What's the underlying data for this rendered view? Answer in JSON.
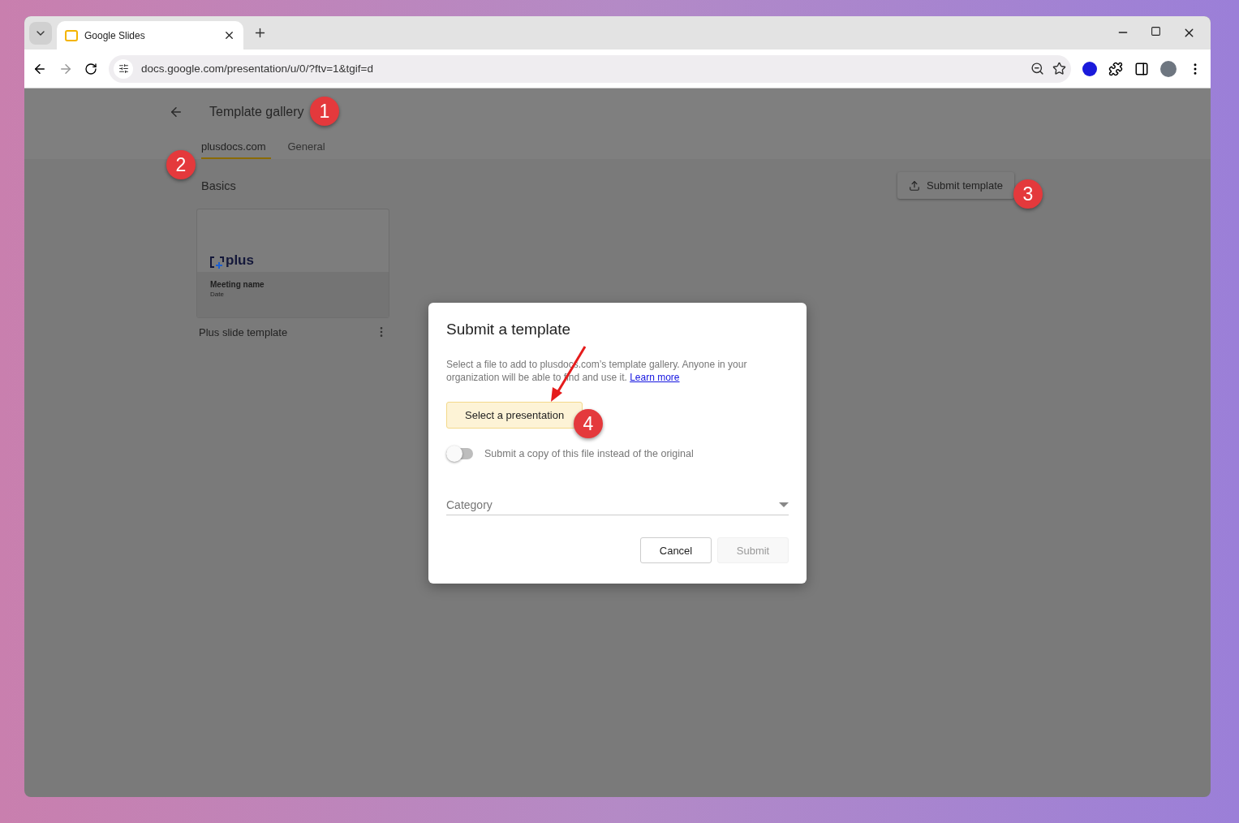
{
  "browser": {
    "tab": {
      "title": "Google Slides",
      "selected": true
    },
    "url": "docs.google.com/presentation/u/0/?ftv=1&tgif=d"
  },
  "page": {
    "title": "Template gallery",
    "tabs": [
      {
        "label": "plusdocs.com",
        "selected": true
      },
      {
        "label": "General",
        "selected": false
      }
    ],
    "section": "Basics",
    "submit_button": "Submit template",
    "templates": [
      {
        "name": "Plus slide template",
        "logo": "plus",
        "heading": "Meeting name",
        "subtitle": "Date"
      }
    ]
  },
  "dialog": {
    "title": "Submit a template",
    "description": "Select a file to add to plusdocs.com’s template gallery. Anyone in your organization will be able to find and use it.",
    "link": "Learn more",
    "select_button": "Select a presentation",
    "toggle": {
      "label": "Submit a copy of this file instead of the original",
      "on": false
    },
    "category": {
      "placeholder": "Category"
    },
    "buttons": [
      {
        "label": "Cancel",
        "disabled": false
      },
      {
        "label": "Submit",
        "disabled": true
      }
    ]
  },
  "callouts": [
    "1",
    "2",
    "3",
    "4"
  ]
}
